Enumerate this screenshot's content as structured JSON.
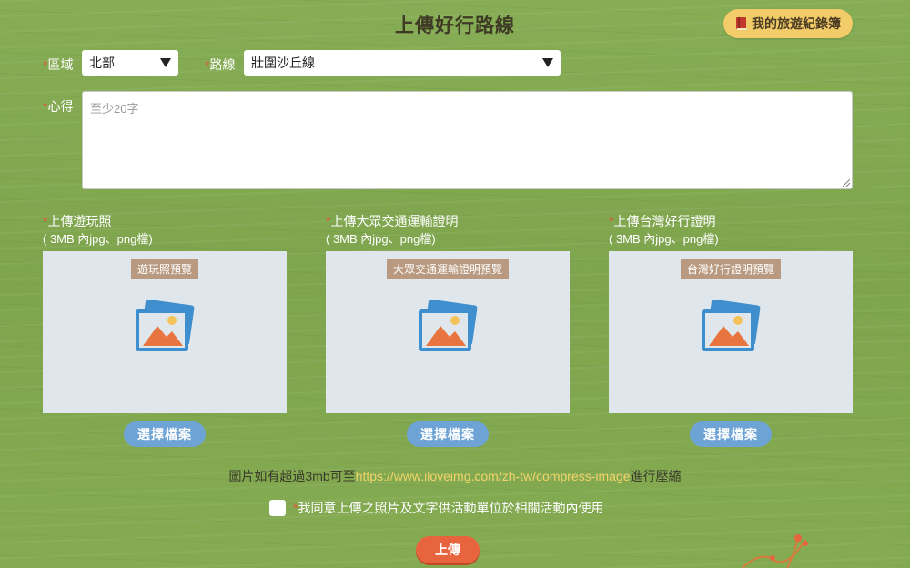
{
  "header": {
    "title": "上傳好行路線",
    "journal_button": "我的旅遊紀錄簿"
  },
  "form": {
    "required_mark": "*",
    "region_label": "區域",
    "region_value": "北部",
    "route_label": "路線",
    "route_value": "壯圍沙丘線",
    "comment_label": "心得",
    "comment_placeholder": "至少20字"
  },
  "uploads": [
    {
      "title": "上傳遊玩照",
      "hint": "( 3MB 內jpg、png檔)",
      "preview_tag": "遊玩照預覽",
      "button": "選擇檔案"
    },
    {
      "title": "上傳大眾交通運輸證明",
      "hint": "( 3MB 內jpg、png檔)",
      "preview_tag": "大眾交通運輸證明預覽",
      "button": "選擇檔案"
    },
    {
      "title": "上傳台灣好行證明",
      "hint": "( 3MB 內jpg、png檔)",
      "preview_tag": "台灣好行證明預覽",
      "button": "選擇檔案"
    }
  ],
  "note": {
    "prefix": "圖片如有超過3mb可至",
    "link": "https://www.iloveimg.com/zh-tw/compress-image",
    "suffix": "進行壓縮"
  },
  "agree": {
    "label": "我同意上傳之照片及文字供活動單位於相關活動內使用",
    "checked": false
  },
  "submit": {
    "label": "上傳"
  },
  "colors": {
    "background": "#7fa84f",
    "accent_orange": "#e8643f",
    "journal_yellow": "#f2cc69",
    "button_blue": "#6ea3d6",
    "preview_bg": "#dfe6ec",
    "link_yellow": "#f3d36a"
  },
  "icons": {
    "journal": "book-icon",
    "preview": "image-placeholder-icon",
    "select": "caret-down-icon"
  }
}
